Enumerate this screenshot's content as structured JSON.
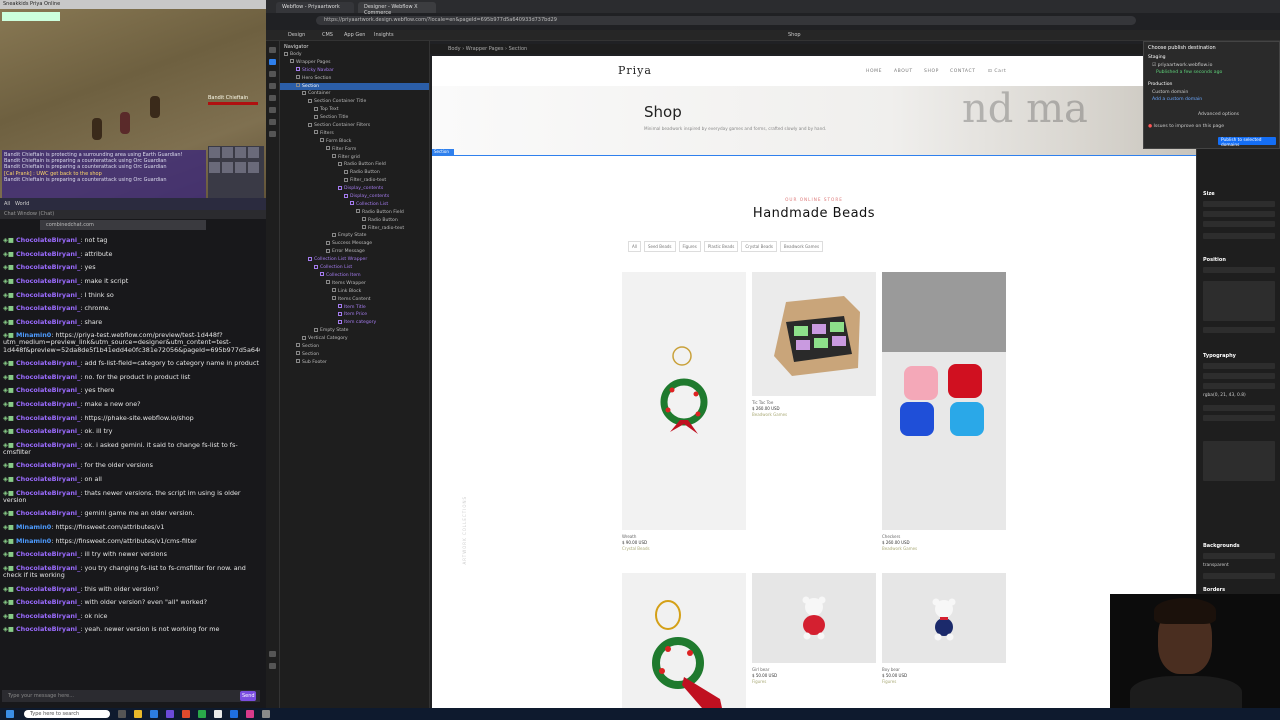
{
  "game": {
    "window_title": "Sneakkids Priya Online",
    "boss_name": "Bandit Chieftain",
    "chat_lines": [
      "Bandit Chieftain is protecting a surrounding area using Earth Guardian!",
      "Bandit Chieftain is preparing a counterattack using Orc Guardian",
      "Bandit Chieftain is preparing a counterattack using Orc Guardian",
      "[Cal Prank] : UWC get back to the shop",
      "Bandit Chieftain is preparing a counterattack using Orc Guardian"
    ],
    "chat_tabs": [
      "All",
      "World"
    ]
  },
  "twitch": {
    "tab": "Chat Window (Chat)",
    "url": "combinedchat.com",
    "messages": [
      {
        "user": "ChocolateBiryani_",
        "color": "#9b6bff",
        "text": "not tag"
      },
      {
        "user": "ChocolateBiryani_",
        "color": "#9b6bff",
        "text": "attribute"
      },
      {
        "user": "ChocolateBiryani_",
        "color": "#9b6bff",
        "text": "yes"
      },
      {
        "user": "ChocolateBiryani_",
        "color": "#9b6bff",
        "text": "make it script"
      },
      {
        "user": "ChocolateBiryani_",
        "color": "#9b6bff",
        "text": "I think so"
      },
      {
        "user": "ChocolateBiryani_",
        "color": "#9b6bff",
        "text": "chrome."
      },
      {
        "user": "ChocolateBiryani_",
        "color": "#9b6bff",
        "text": "share"
      },
      {
        "user": "Minamin0",
        "color": "#4d9bff",
        "text": "https://priya-test.webflow.com/preview/test-1d448f?utm_medium=preview_link&utm_source=designer&utm_content=test-1d448f&preview=52da8de5f1b41edd4e0fc381e72056&pageId=695b977d5a640933d737bd29&locale=en&workflow=preview"
      },
      {
        "user": "ChocolateBiryani_",
        "color": "#9b6bff",
        "text": "add fs-list-field=category to category name in product"
      },
      {
        "user": "ChocolateBiryani_",
        "color": "#9b6bff",
        "text": "no. for the product in product list"
      },
      {
        "user": "ChocolateBiryani_",
        "color": "#9b6bff",
        "text": "yes there"
      },
      {
        "user": "ChocolateBiryani_",
        "color": "#9b6bff",
        "text": "make a new one?"
      },
      {
        "user": "ChocolateBiryani_",
        "color": "#9b6bff",
        "text": "https://phake-site.webflow.io/shop"
      },
      {
        "user": "ChocolateBiryani_",
        "color": "#9b6bff",
        "text": "ok. ill try"
      },
      {
        "user": "ChocolateBiryani_",
        "color": "#9b6bff",
        "text": "ok. i asked gemini. it said to change fs-list to fs-cmsfilter"
      },
      {
        "user": "ChocolateBiryani_",
        "color": "#9b6bff",
        "text": "for the older versions"
      },
      {
        "user": "ChocolateBiryani_",
        "color": "#9b6bff",
        "text": "on all"
      },
      {
        "user": "ChocolateBiryani_",
        "color": "#9b6bff",
        "text": "thats newer versions. the script im using is older version"
      },
      {
        "user": "ChocolateBiryani_",
        "color": "#9b6bff",
        "text": "gemini game me an older version."
      },
      {
        "user": "Minamin0",
        "color": "#4d9bff",
        "text": "https://finsweet.com/attributes/v1"
      },
      {
        "user": "Minamin0",
        "color": "#4d9bff",
        "text": "https://finsweet.com/attributes/v1/cms-filter"
      },
      {
        "user": "ChocolateBiryani_",
        "color": "#9b6bff",
        "text": "ill try with newer versions"
      },
      {
        "user": "ChocolateBiryani_",
        "color": "#9b6bff",
        "text": "you try changing fs-list to fs-cmsfilter for now. and check if its working"
      },
      {
        "user": "ChocolateBiryani_",
        "color": "#9b6bff",
        "text": "this with older version?"
      },
      {
        "user": "ChocolateBiryani_",
        "color": "#9b6bff",
        "text": "with older version? even \"all\" worked?"
      },
      {
        "user": "ChocolateBiryani_",
        "color": "#9b6bff",
        "text": "ok nice"
      },
      {
        "user": "ChocolateBiryani_",
        "color": "#9b6bff",
        "text": "yeah. newer version is not working for me"
      }
    ],
    "input_placeholder": "Type your message here...",
    "send_label": "Send"
  },
  "taskbar": {
    "search_placeholder": "Type here to search"
  },
  "browser": {
    "tabs": [
      "Webflow - Priyaartwork",
      "Designer - Webflow X Commerce"
    ],
    "url": "https://priyaartwork.design.webflow.com/?locale=en&pageId=695b977d5a640933d737bd29"
  },
  "webflow": {
    "top_items": [
      "Design",
      "CMS",
      "App Gen",
      "Insights"
    ],
    "page_label": "Shop",
    "breadcrumb": "Body  ›  Wrapper Pages  ›  Section",
    "navigator_title": "Navigator",
    "navigator": [
      {
        "label": "Body",
        "indent": 0,
        "comp": false,
        "sel": false
      },
      {
        "label": "Wrapper Pages",
        "indent": 1,
        "comp": false,
        "sel": false
      },
      {
        "label": "Sticky Navbar",
        "indent": 2,
        "comp": true,
        "sel": false
      },
      {
        "label": "Hero Section",
        "indent": 2,
        "comp": false,
        "sel": false
      },
      {
        "label": "Section",
        "indent": 2,
        "comp": false,
        "sel": true
      },
      {
        "label": "Container",
        "indent": 3,
        "comp": false,
        "sel": false
      },
      {
        "label": "Section Container Title",
        "indent": 4,
        "comp": false,
        "sel": false
      },
      {
        "label": "Top Text",
        "indent": 5,
        "comp": false,
        "sel": false
      },
      {
        "label": "Section Title",
        "indent": 5,
        "comp": false,
        "sel": false
      },
      {
        "label": "Section Container Filters",
        "indent": 4,
        "comp": false,
        "sel": false
      },
      {
        "label": "Filters",
        "indent": 5,
        "comp": false,
        "sel": false
      },
      {
        "label": "Form Block",
        "indent": 6,
        "comp": false,
        "sel": false
      },
      {
        "label": "Filter Form",
        "indent": 7,
        "comp": false,
        "sel": false
      },
      {
        "label": "Filter grid",
        "indent": 8,
        "comp": false,
        "sel": false
      },
      {
        "label": "Radio Button Field",
        "indent": 9,
        "comp": false,
        "sel": false
      },
      {
        "label": "Radio Button",
        "indent": 10,
        "comp": false,
        "sel": false
      },
      {
        "label": "Filter_radio-text",
        "indent": 10,
        "comp": false,
        "sel": false
      },
      {
        "label": "Display_contents",
        "indent": 9,
        "comp": true,
        "sel": false
      },
      {
        "label": "Display_contents",
        "indent": 10,
        "comp": true,
        "sel": false
      },
      {
        "label": "Collection List",
        "indent": 11,
        "comp": true,
        "sel": false
      },
      {
        "label": "Radio Button Field",
        "indent": 12,
        "comp": false,
        "sel": false
      },
      {
        "label": "Radio Button",
        "indent": 13,
        "comp": false,
        "sel": false
      },
      {
        "label": "Filter_radio-text",
        "indent": 13,
        "comp": false,
        "sel": false
      },
      {
        "label": "Empty State",
        "indent": 8,
        "comp": false,
        "sel": false
      },
      {
        "label": "Success Message",
        "indent": 7,
        "comp": false,
        "sel": false
      },
      {
        "label": "Error Message",
        "indent": 7,
        "comp": false,
        "sel": false
      },
      {
        "label": "Collection List Wrapper",
        "indent": 4,
        "comp": true,
        "sel": false
      },
      {
        "label": "Collection List",
        "indent": 5,
        "comp": true,
        "sel": false
      },
      {
        "label": "Collection Item",
        "indent": 6,
        "comp": true,
        "sel": false
      },
      {
        "label": "Items Wrapper",
        "indent": 7,
        "comp": false,
        "sel": false
      },
      {
        "label": "Link Block",
        "indent": 8,
        "comp": false,
        "sel": false
      },
      {
        "label": "Items Content",
        "indent": 8,
        "comp": false,
        "sel": false
      },
      {
        "label": "Item Title",
        "indent": 9,
        "comp": true,
        "sel": false
      },
      {
        "label": "Item Price",
        "indent": 9,
        "comp": true,
        "sel": false
      },
      {
        "label": "Item category",
        "indent": 9,
        "comp": true,
        "sel": false
      },
      {
        "label": "Empty State",
        "indent": 5,
        "comp": false,
        "sel": false
      },
      {
        "label": "Vertical Category",
        "indent": 3,
        "comp": false,
        "sel": false
      },
      {
        "label": "Section",
        "indent": 2,
        "comp": false,
        "sel": false
      },
      {
        "label": "Section",
        "indent": 2,
        "comp": false,
        "sel": false
      },
      {
        "label": "Sub Footer",
        "indent": 2,
        "comp": false,
        "sel": false
      }
    ],
    "publish": {
      "title": "Choose publish destination",
      "staging": "Staging",
      "staging_url": "priyaartwork.webflow.io",
      "staging_status": "Published a few seconds ago",
      "production": "Production",
      "custom_domain": "Custom domain",
      "add_domain": "Add a custom domain",
      "advanced": "Advanced options",
      "issues": "Issues to improve on this page",
      "button": "Publish to selected domains"
    },
    "right_sections": [
      "Size",
      "Position",
      "Typography",
      "Backgrounds",
      "Borders"
    ],
    "typo_color": "rgba(0, 21, 43, 0.8)",
    "bg_color": "transparent"
  },
  "site": {
    "logo": "Priya",
    "nav": [
      "HOME",
      "ABOUT",
      "SHOP",
      "CONTACT"
    ],
    "cart": "Cart",
    "hero_title": "Shop",
    "hero_sub": "Minimal beadwork inspired by everyday games and forms, crafted slowly and by hand.",
    "hero_deco": "nd ma",
    "section_tag": "Section",
    "eyebrow": "OUR ONLINE STORE",
    "title": "Handmade Beads",
    "filters": [
      "All",
      "Seed Beads",
      "Figures",
      "Plastic Beads",
      "Crystal Beads",
      "Beadwork Games"
    ],
    "side_text": "ARTWORK COLLECTIONS",
    "products": [
      {
        "name": "Wreath",
        "price": "$ 90.00 USD",
        "category": "Crystal Beads",
        "tone": "#f1f1f1"
      },
      {
        "name": "Tic Tac Toe",
        "price": "$ 260.00 USD",
        "category": "Beadwork Games",
        "tone": "#ebebeb"
      },
      {
        "name": "Checkers",
        "price": "$ 260.00 USD",
        "category": "Beadwork Games",
        "tone": "#e7e7e7"
      },
      {
        "name": "",
        "price": "",
        "category": "",
        "tone": "#f1f1f1"
      },
      {
        "name": "Girl bear",
        "price": "$ 50.00 USD",
        "category": "Figures",
        "tone": "#e6e6e6"
      },
      {
        "name": "Boy bear",
        "price": "$ 50.00 USD",
        "category": "Figures",
        "tone": "#e6e6e6"
      }
    ]
  }
}
